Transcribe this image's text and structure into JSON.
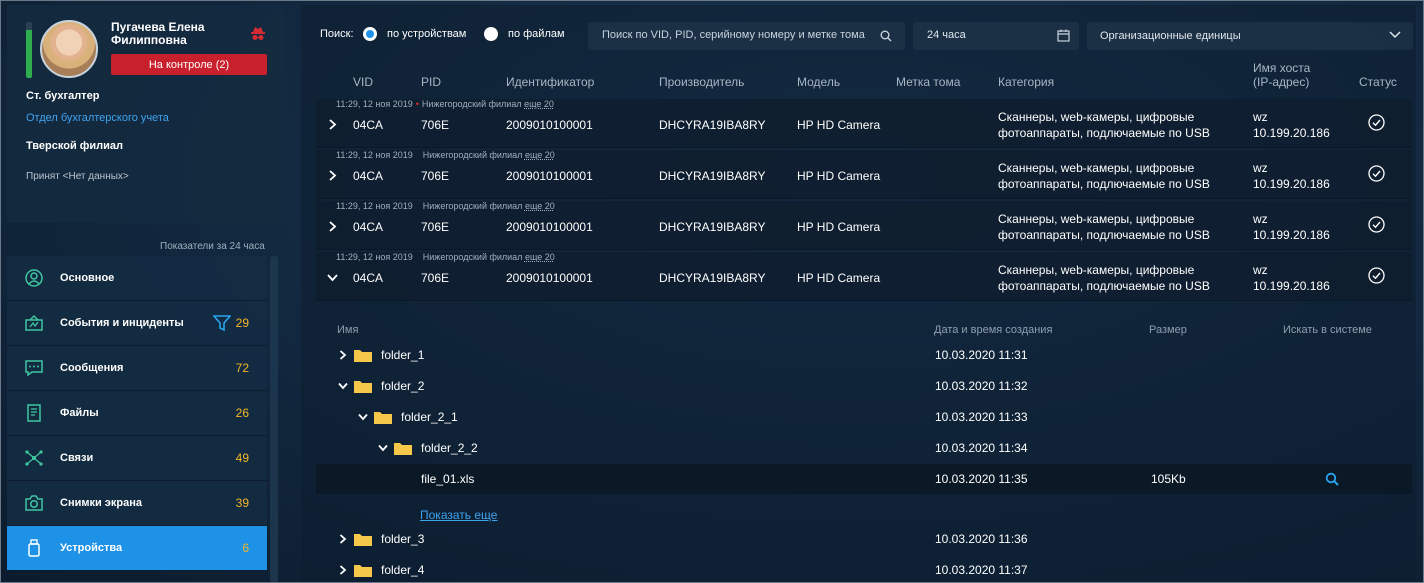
{
  "profile": {
    "name": "Пугачева Елена Филипповна",
    "control_badge": "На контроле (2)",
    "role": "Ст. бухгалтер",
    "department": "Отдел бухгалтерского учета",
    "branch": "Тверской филиал",
    "accepted": "Принят <Нет данных>",
    "activity_level": 0.85,
    "colors": {
      "badge": "#c8202c",
      "level": "#2fae4e",
      "link": "#3fa4f0"
    }
  },
  "indicators_title": "Показатели за 24 часа",
  "nav": [
    {
      "label": "Основное",
      "count": "",
      "icon": "user-circle-icon"
    },
    {
      "label": "События и инциденты",
      "count": "29",
      "icon": "incident-icon"
    },
    {
      "label": "Сообщения",
      "count": "72",
      "icon": "chat-icon"
    },
    {
      "label": "Файлы",
      "count": "26",
      "icon": "file-icon"
    },
    {
      "label": "Связи",
      "count": "49",
      "icon": "network-icon"
    },
    {
      "label": "Снимки экрана",
      "count": "39",
      "icon": "camera-icon"
    },
    {
      "label": "Устройства",
      "count": "6",
      "icon": "usb-icon",
      "active": true
    }
  ],
  "search": {
    "label": "Поиск:",
    "by_devices": "по устройствам",
    "by_files": "по файлам",
    "placeholder": "Поиск по VID, PID, серийному номеру и метке тома",
    "period": "24 часа",
    "org_units": "Организационные единицы"
  },
  "columns": {
    "vid": "VID",
    "pid": "PID",
    "id": "Идентификатор",
    "vendor": "Производитель",
    "model": "Модель",
    "volume": "Метка тома",
    "category": "Категория",
    "host_1": "Имя хоста",
    "host_2": "(IP-адрес)",
    "status": "Статус"
  },
  "devices": [
    {
      "time": "11:29, 12 ноя 2019",
      "branch": "Нижегородский филиал",
      "more": "еще 20",
      "vid": "04CA",
      "pid": "706E",
      "id": "2009010100001",
      "vendor": "DHCYRA19IBA8RY",
      "model": "HP HD Camera",
      "category_1": "Сканнеры, web-камеры, цифровые",
      "category_2": "фотоаппараты, подлючаемые по USB",
      "host": "wz",
      "ip": "10.199.20.186",
      "expanded": false,
      "unread": true
    },
    {
      "time": "11:29, 12 ноя 2019",
      "branch": "Нижегородский филиал",
      "more": "еще 20",
      "vid": "04CA",
      "pid": "706E",
      "id": "2009010100001",
      "vendor": "DHCYRA19IBA8RY",
      "model": "HP HD Camera",
      "category_1": "Сканнеры, web-камеры, цифровые",
      "category_2": "фотоаппараты, подлючаемые по USB",
      "host": "wz",
      "ip": "10.199.20.186",
      "expanded": false,
      "unread": false
    },
    {
      "time": "11:29, 12 ноя 2019",
      "branch": "Нижегородский филиал",
      "more": "еще 20",
      "vid": "04CA",
      "pid": "706E",
      "id": "2009010100001",
      "vendor": "DHCYRA19IBA8RY",
      "model": "HP HD Camera",
      "category_1": "Сканнеры, web-камеры, цифровые",
      "category_2": "фотоаппараты, подлючаемые по USB",
      "host": "wz",
      "ip": "10.199.20.186",
      "expanded": false,
      "unread": false
    },
    {
      "time": "11:29, 12 ноя 2019",
      "branch": "Нижегородский филиал",
      "more": "еще 20",
      "vid": "04CA",
      "pid": "706E",
      "id": "2009010100001",
      "vendor": "DHCYRA19IBA8RY",
      "model": "HP HD Camera",
      "category_1": "Сканнеры, web-камеры, цифровые",
      "category_2": "фотоаппараты, подлючаемые по USB",
      "host": "wz",
      "ip": "10.199.20.186",
      "expanded": true,
      "unread": false
    }
  ],
  "files": {
    "head_name": "Имя",
    "head_date": "Дата и время создания",
    "head_size": "Размер",
    "head_search": "Искать в системе",
    "show_more": "Показать еще",
    "rows": [
      {
        "name": "folder_1",
        "date": "10.03.2020 11:31",
        "size": "",
        "level": 0,
        "type": "folder",
        "expanded": false
      },
      {
        "name": "folder_2",
        "date": "10.03.2020 11:32",
        "size": "",
        "level": 0,
        "type": "folder",
        "expanded": true
      },
      {
        "name": "folder_2_1",
        "date": "10.03.2020 11:33",
        "size": "",
        "level": 1,
        "type": "folder",
        "expanded": true
      },
      {
        "name": "folder_2_2",
        "date": "10.03.2020 11:34",
        "size": "",
        "level": 2,
        "type": "folder",
        "expanded": true
      },
      {
        "name": "file_01.xls",
        "date": "10.03.2020 11:35",
        "size": "105Kb",
        "level": 3,
        "type": "file",
        "expanded": false
      },
      {
        "name": "folder_3",
        "date": "10.03.2020 11:36",
        "size": "",
        "level": 0,
        "type": "folder",
        "expanded": false
      },
      {
        "name": "folder_4",
        "date": "10.03.2020 11:37",
        "size": "",
        "level": 0,
        "type": "folder",
        "expanded": false
      }
    ]
  }
}
